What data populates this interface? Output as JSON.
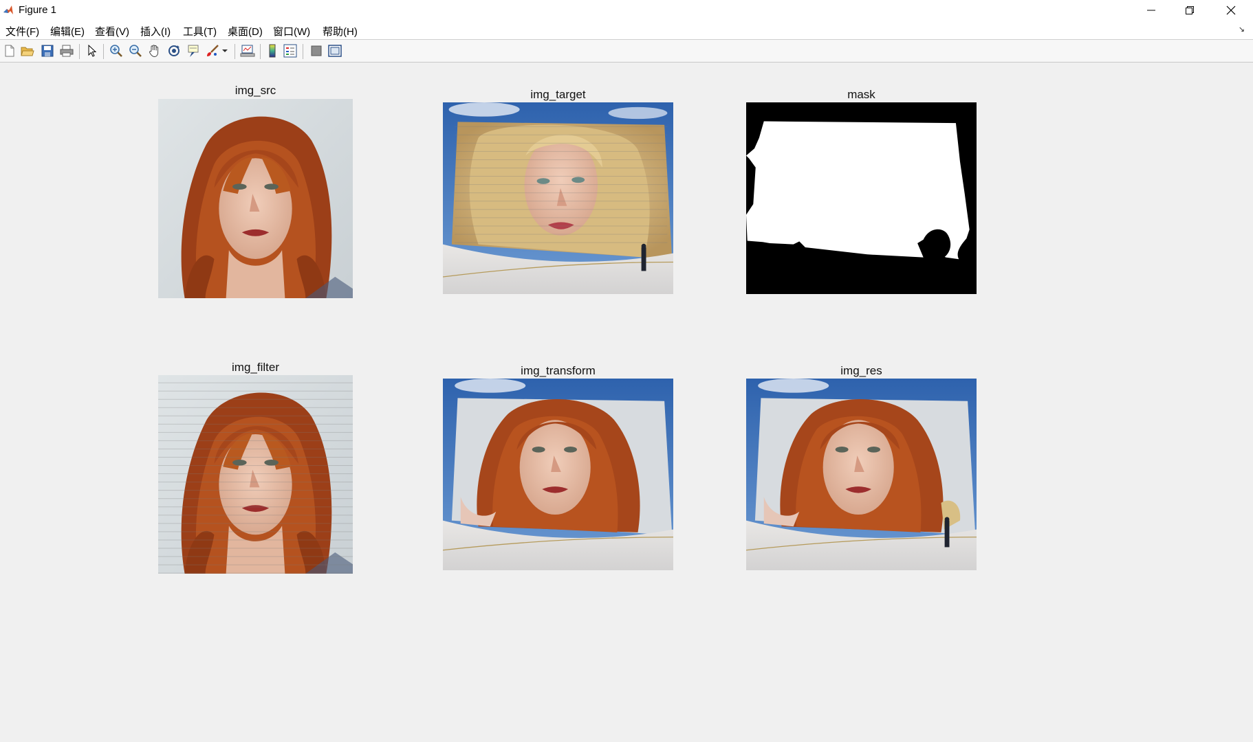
{
  "window": {
    "title": "Figure 1",
    "icons": {
      "app": "matlab-logo-icon",
      "minimize": "minimize-icon",
      "maximize": "restore-icon",
      "close": "close-icon"
    }
  },
  "menu": {
    "items": [
      "文件(F)",
      "编辑(E)",
      "查看(V)",
      "插入(I)",
      "工具(T)",
      "桌面(D)",
      "窗口(W)",
      "帮助(H)"
    ],
    "corner_arrow": "↘"
  },
  "toolbar": {
    "buttons": [
      "new-figure-icon",
      "open-file-icon",
      "save-icon",
      "print-icon",
      "pointer-icon",
      "zoom-in-icon",
      "zoom-out-icon",
      "pan-hand-icon",
      "rotate-3d-icon",
      "data-cursor-icon",
      "brush-icon",
      "dropdown-arrow-icon",
      "link-plot-icon",
      "colorbar-icon",
      "legend-icon",
      "hide-plot-tools-icon",
      "show-plot-tools-icon"
    ]
  },
  "axes": [
    {
      "title": "img_src"
    },
    {
      "title": "img_target"
    },
    {
      "title": "mask"
    },
    {
      "title": "img_filter"
    },
    {
      "title": "img_transform"
    },
    {
      "title": "img_res"
    }
  ],
  "colors": {
    "background": "#f0f0f0",
    "hair": "#a8471d",
    "skin": "#e3b9a3",
    "blonde": "#d9c08c",
    "sky": "#2e67b6",
    "wall": "#dcdedd",
    "mask_white": "#ffffff",
    "mask_black": "#000000"
  }
}
